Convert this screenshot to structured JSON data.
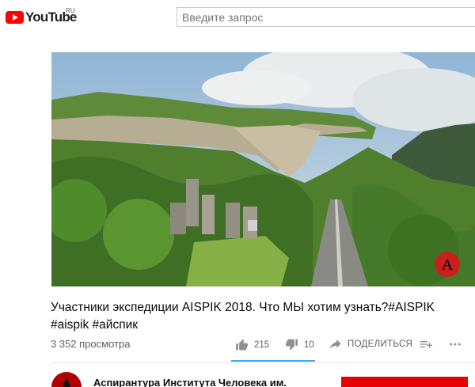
{
  "masthead": {
    "logo_text": "YouTube",
    "logo_region": "RU",
    "search_placeholder": "Введите запрос"
  },
  "video": {
    "title": "Участники экспедиции AISPIK 2018. Что МЫ хотим узнать?#AISPIK #aispik #айспик",
    "views": "3 352 просмотра",
    "likes": "215",
    "dislikes": "10",
    "share_label": "ПОДЕЛИТЬСЯ",
    "like_ratio": 0.956,
    "watermark_letter": "A",
    "icons": [
      "thumb-up-icon",
      "thumb-down-icon",
      "share-icon",
      "add-to-playlist-icon",
      "more-icon"
    ]
  },
  "channel": {
    "name": "Аспирантура Института Человека им. Кабардино",
    "subscribe_label": ""
  },
  "colors": {
    "brand_red": "#ff0000",
    "subscribe_red": "#e60000",
    "sentiment_blue": "#3ea6ff",
    "secondary_text": "#606060"
  }
}
